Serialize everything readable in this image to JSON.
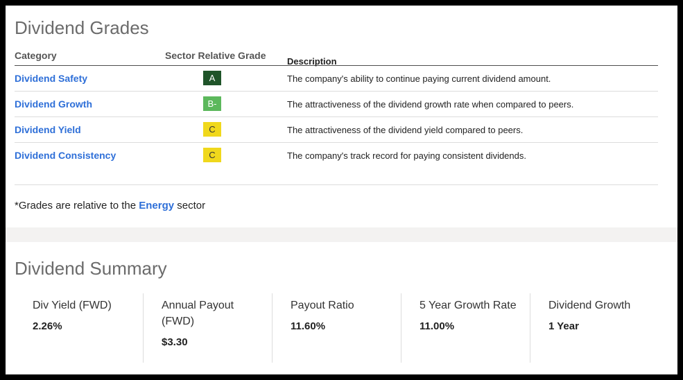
{
  "grades": {
    "title": "Dividend Grades",
    "headers": {
      "category": "Category",
      "grade": "Sector Relative Grade",
      "description": "Description"
    },
    "rows": [
      {
        "category": "Dividend Safety",
        "grade": "A",
        "grade_bg": "#1f5429",
        "grade_fg": "#ffffff",
        "description": "The company's ability to continue paying current dividend amount."
      },
      {
        "category": "Dividend Growth",
        "grade": "B-",
        "grade_bg": "#5cb85c",
        "grade_fg": "#ffffff",
        "description": "The attractiveness of the dividend growth rate when compared to peers."
      },
      {
        "category": "Dividend Yield",
        "grade": "C",
        "grade_bg": "#f0d81c",
        "grade_fg": "#333333",
        "description": "The attractiveness of the dividend yield compared to peers."
      },
      {
        "category": "Dividend Consistency",
        "grade": "C",
        "grade_bg": "#f0d81c",
        "grade_fg": "#333333",
        "description": "The company's track record for paying consistent dividends."
      }
    ],
    "footnote": {
      "prefix": "*Grades are relative to the ",
      "sector": "Energy",
      "suffix": " sector"
    }
  },
  "summary": {
    "title": "Dividend Summary",
    "metrics": [
      {
        "label": "Div Yield (FWD)",
        "value": "2.26%"
      },
      {
        "label": "Annual Payout (FWD)",
        "value": "$3.30"
      },
      {
        "label": "Payout Ratio",
        "value": "11.60%"
      },
      {
        "label": "5 Year Growth Rate",
        "value": "11.00%"
      },
      {
        "label": "Dividend Growth",
        "value": "1 Year"
      }
    ]
  },
  "colors": {
    "link": "#2e6fd8",
    "title": "#6b6b6b",
    "band": "#f3f2f1"
  }
}
